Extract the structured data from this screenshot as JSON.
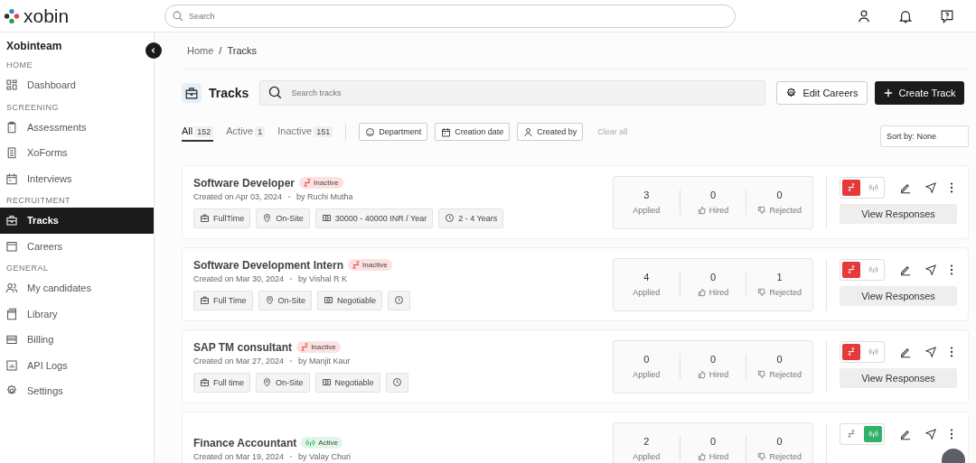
{
  "header": {
    "logo": "xobin",
    "search": {
      "placeholder": "Search"
    }
  },
  "sidebar": {
    "team": "Xobinteam",
    "sections": [
      {
        "title": "HOME",
        "items": [
          {
            "label": "Dashboard",
            "selected": false
          }
        ]
      },
      {
        "title": "SCREENING",
        "items": [
          {
            "label": "Assessments",
            "selected": false
          },
          {
            "label": "XoForms",
            "selected": false
          },
          {
            "label": "Interviews",
            "selected": false
          }
        ]
      },
      {
        "title": "RECRUITMENT",
        "items": [
          {
            "label": "Tracks",
            "selected": true
          },
          {
            "label": "Careers",
            "selected": false
          }
        ]
      },
      {
        "title": "GENERAL",
        "items": [
          {
            "label": "My candidates",
            "selected": false
          },
          {
            "label": "Library",
            "selected": false
          },
          {
            "label": "Billing",
            "selected": false
          },
          {
            "label": "API Logs",
            "selected": false
          },
          {
            "label": "Settings",
            "selected": false
          }
        ]
      }
    ]
  },
  "breadcrumb": {
    "items": [
      "Home",
      "Tracks"
    ],
    "separator": "/"
  },
  "page": {
    "title": "Tracks",
    "search": {
      "placeholder": "Search tracks"
    },
    "edit_button": "Edit Careers",
    "create_button": "Create Track"
  },
  "tabs": [
    {
      "label": "All",
      "count": "152",
      "selected": true
    },
    {
      "label": "Active",
      "count": "1",
      "selected": false
    },
    {
      "label": "Inactive",
      "count": "151",
      "selected": false
    }
  ],
  "filters": [
    {
      "label": "Department"
    },
    {
      "label": "Creation date"
    },
    {
      "label": "Created by"
    }
  ],
  "clear_all": "Clear all",
  "sort": "Sort by: None",
  "tracks": [
    {
      "title": "Software Developer",
      "kind": "inactive",
      "status_label": "Inactive",
      "created": "Created on Apr 03, 2024",
      "by": "by Ruchi Mutha",
      "tags": [
        {
          "kind": "type",
          "label": "FullTime"
        },
        {
          "kind": "location",
          "label": "On-Site"
        },
        {
          "kind": "salary",
          "label": "30000 - 40000 INR / Year"
        },
        {
          "kind": "experience",
          "label": "2 - 4 Years"
        }
      ],
      "stats": [
        {
          "value": "3",
          "label": "Applied",
          "kind": "applied"
        },
        {
          "value": "0",
          "label": "Hired",
          "kind": "hired"
        },
        {
          "value": "0",
          "label": "Rejected",
          "kind": "rejected"
        }
      ],
      "button": "View Responses"
    },
    {
      "title": "Software Development Intern",
      "kind": "inactive",
      "status_label": "Inactive",
      "created": "Created on Mar 30, 2024",
      "by": "by Vishal R K",
      "tags": [
        {
          "kind": "type",
          "label": "Full Time"
        },
        {
          "kind": "location",
          "label": "On-Site"
        },
        {
          "kind": "salary",
          "label": "Negotiable"
        },
        {
          "kind": "experience"
        }
      ],
      "stats": [
        {
          "value": "4",
          "label": "Applied",
          "kind": "applied"
        },
        {
          "value": "0",
          "label": "Hired",
          "kind": "hired"
        },
        {
          "value": "1",
          "label": "Rejected",
          "kind": "rejected"
        }
      ],
      "button": "View Responses"
    },
    {
      "title": "SAP TM consultant",
      "kind": "inactive",
      "status_label": "Inactive",
      "created": "Created on Mar 27, 2024",
      "by": "by Manjit Kaur",
      "tags": [
        {
          "kind": "type",
          "label": "Full time"
        },
        {
          "kind": "location",
          "label": "On-Site"
        },
        {
          "kind": "salary",
          "label": "Negotiable"
        },
        {
          "kind": "experience"
        }
      ],
      "stats": [
        {
          "value": "0",
          "label": "Applied",
          "kind": "applied"
        },
        {
          "value": "0",
          "label": "Hired",
          "kind": "hired"
        },
        {
          "value": "0",
          "label": "Rejected",
          "kind": "rejected"
        }
      ],
      "button": "View Responses"
    },
    {
      "title": "Finance Accountant",
      "kind": "active",
      "status_label": "Active",
      "created": "Created on Mar 19, 2024",
      "by": "by Valay Churi",
      "stats": [
        {
          "value": "2",
          "label": "Applied",
          "kind": "applied"
        },
        {
          "value": "0",
          "label": "Hired",
          "kind": "hired"
        },
        {
          "value": "0",
          "label": "Rejected",
          "kind": "rejected"
        }
      ]
    }
  ]
}
